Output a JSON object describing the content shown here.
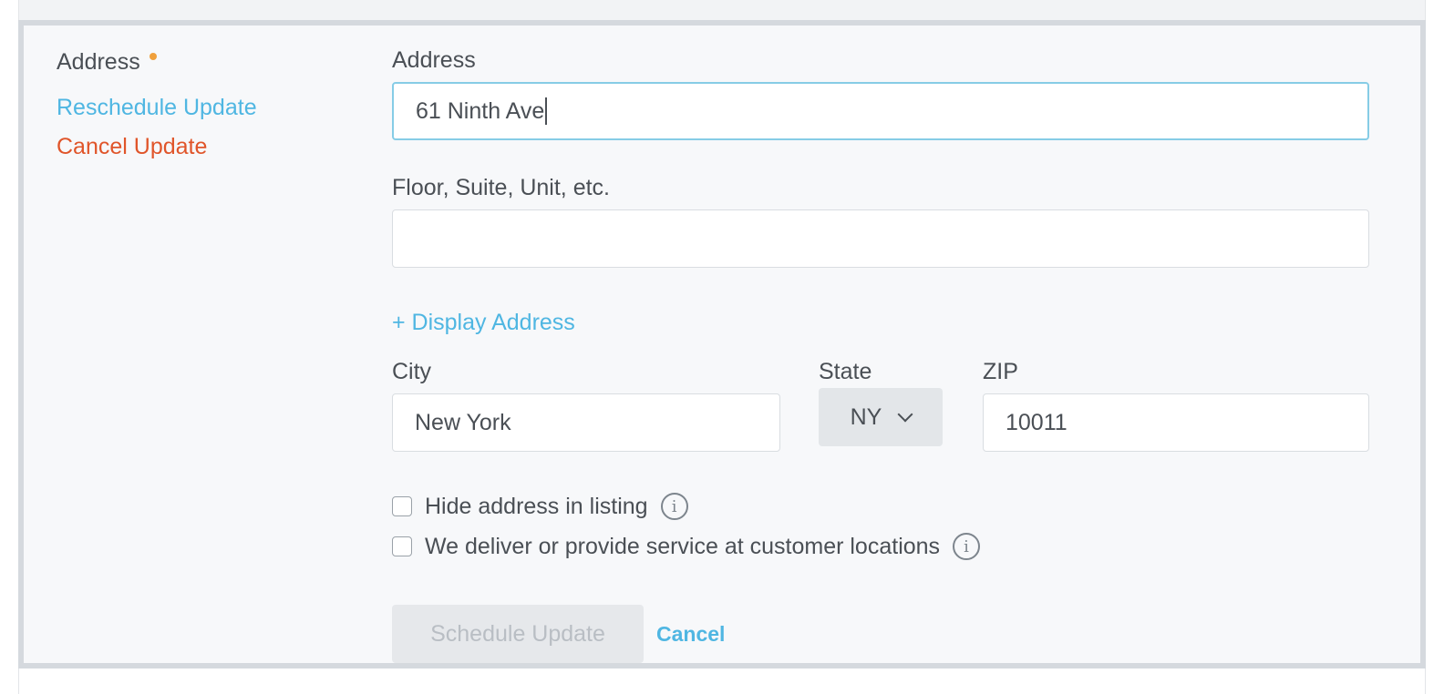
{
  "sidebar": {
    "title": "Address",
    "reschedule_label": "Reschedule Update",
    "cancel_label": "Cancel Update",
    "required_dot_color": "#f0a03b"
  },
  "form": {
    "address": {
      "label": "Address",
      "value": "61 Ninth Ave"
    },
    "floor": {
      "label": "Floor, Suite, Unit, etc.",
      "value": ""
    },
    "display_address_label": "+ Display Address",
    "city": {
      "label": "City",
      "value": "New York"
    },
    "state": {
      "label": "State",
      "value": "NY"
    },
    "zip": {
      "label": "ZIP",
      "value": "10011"
    },
    "checkboxes": [
      {
        "label": "Hide address in listing",
        "checked": false
      },
      {
        "label": "We deliver or provide service at customer locations",
        "checked": false
      }
    ],
    "schedule_button": "Schedule Update",
    "cancel_button": "Cancel"
  },
  "colors": {
    "link": "#4fb6e2",
    "danger": "#e0552a",
    "panel_bg": "#f7f8fa",
    "panel_border": "#d5d9de"
  }
}
